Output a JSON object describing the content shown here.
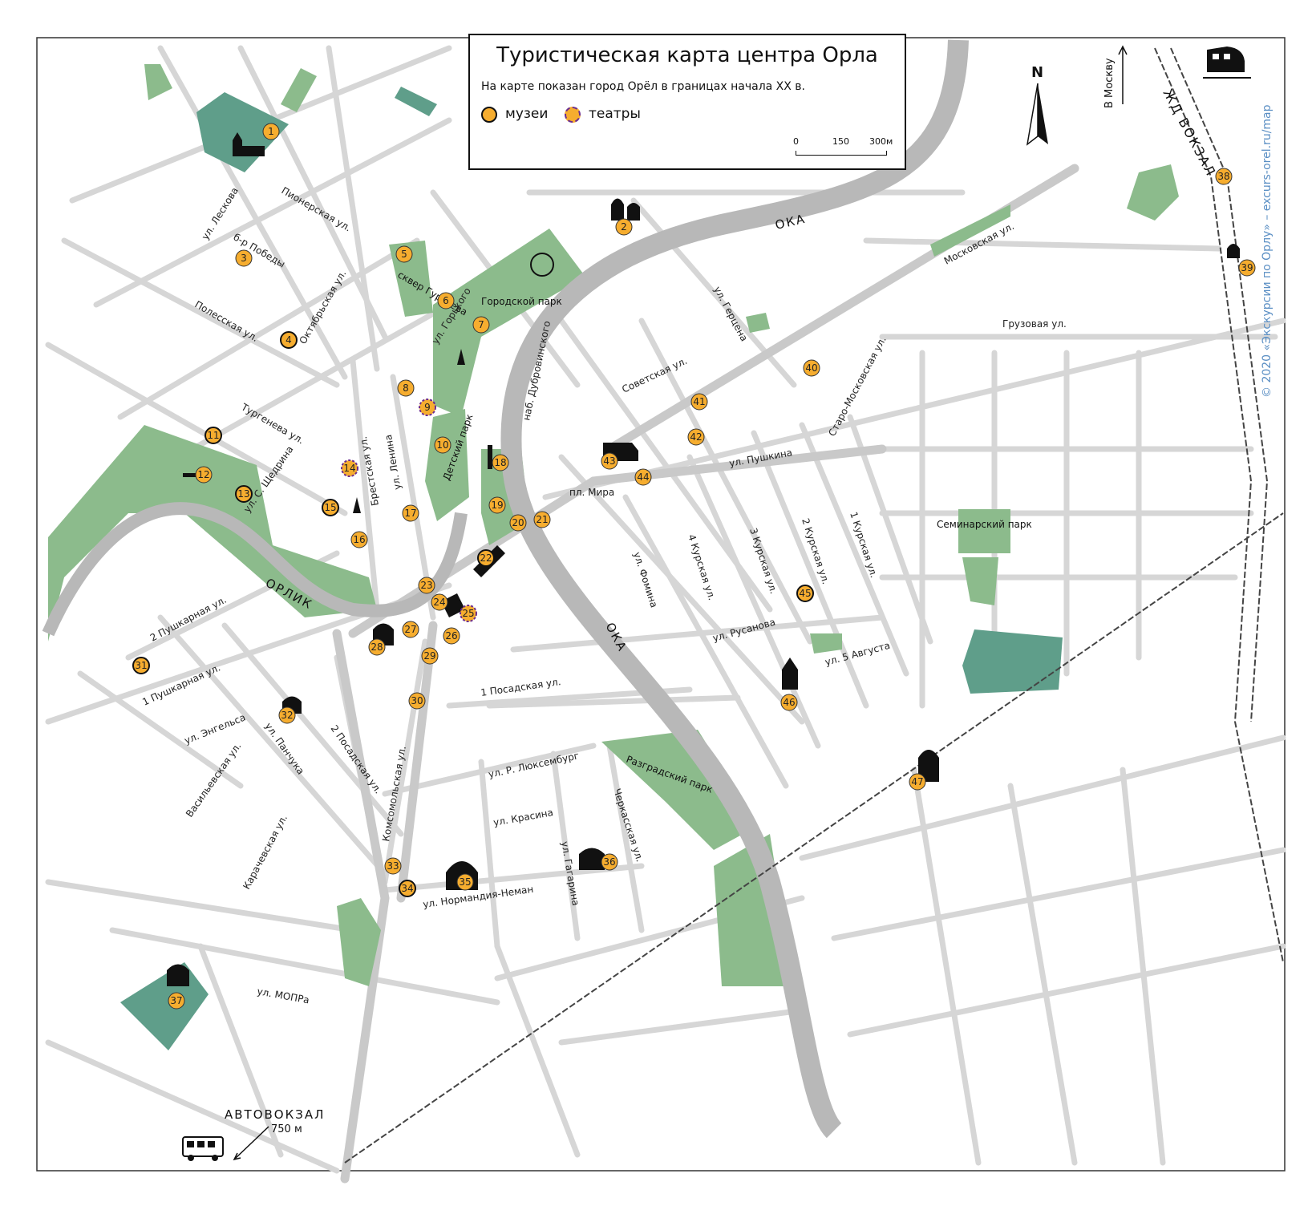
{
  "legend": {
    "title": "Туристическая карта центра Орла",
    "subtitle": "На карте показан город Орёл в границах начала XX в.",
    "museums_label": "музеи",
    "theatres_label": "театры",
    "scale_ticks": [
      "0",
      "150",
      "300м"
    ]
  },
  "compass": {
    "label": "N"
  },
  "direction": {
    "moscow": "В Москву",
    "railway_station": "ЖД ВОКЗАЛ"
  },
  "bus_station": {
    "label": "АВТОВОКЗАЛ",
    "distance": "750 м"
  },
  "copyright": "© 2020 «Экскурсии по Орлу» – excurs-orel.ru/map",
  "rivers": {
    "oka": "ОКА",
    "orlik": "ОРЛИК"
  },
  "parks": {
    "gorodskoy": "Городской парк",
    "detskiy": "Детский парк",
    "skver": "сквер Гуртьева",
    "seminarskiy": "Семинарский парк",
    "razgradskiy": "Разградский парк"
  },
  "streets": {
    "leskova": "ул. Лескова",
    "pionerskaya": "Пионерская ул.",
    "pobedy": "б-р Победы",
    "polesskaya": "Полесская ул.",
    "oktyabrskaya": "Октябрьская ул.",
    "gorkogo": "ул. Горького",
    "turgeneva": "Тургенева ул.",
    "shchedrina": "ул. С. Щедрина",
    "brestskaya": "Брестская ул.",
    "lenina": "ул. Ленина",
    "dubrovinskogo": "наб. Дубровинского",
    "sovetskaya": "Советская ул.",
    "gertsena": "ул. Герцена",
    "moskovskaya": "Московская ул.",
    "gruzovaya": "Грузовая ул.",
    "staro_moskovskaya": "Старо-Московская ул.",
    "pushkina": "ул. Пушкина",
    "pl_mira": "пл. Мира",
    "fomina": "ул. Фомина",
    "kurskaya4": "4 Курская ул.",
    "kurskaya3": "3 Курская ул.",
    "kurskaya2": "2 Курская ул.",
    "kurskaya1": "1 Курская ул.",
    "rusanova": "ул. Русанова",
    "avgusta": "ул. 5 Августа",
    "pushkarnaya2": "2 Пушкарная ул.",
    "pushkarnaya1": "1 Пушкарная ул.",
    "posadskaya1": "1 Посадская ул.",
    "posadskaya2": "2 Посадская ул.",
    "engelsa": "ул. Энгельса",
    "panchuka": "ул. Панчука",
    "vasilevskaya": "Васильевская ул.",
    "komsomolskaya": "Комсомольская ул.",
    "lyuksemburg": "ул. Р. Люксембург",
    "cherkasskaya": "Черкасская ул.",
    "krasina": "ул. Красина",
    "gagarina": "ул. Гагарина",
    "normandiya": "ул. Нормандия-Неман",
    "karachevskaya": "Карачевская ул.",
    "mopra": "ул. МОПРа"
  },
  "pois": {
    "p1": "1",
    "p2": "2",
    "p3": "3",
    "p4": "4",
    "p5": "5",
    "p6": "6",
    "p7": "7",
    "p8": "8",
    "p9": "9",
    "p10": "10",
    "p11": "11",
    "p12": "12",
    "p13": "13",
    "p14": "14",
    "p15": "15",
    "p16": "16",
    "p17": "17",
    "p18": "18",
    "p19": "19",
    "p20": "20",
    "p21": "21",
    "p22": "22",
    "p23": "23",
    "p24": "24",
    "p25": "25",
    "p26": "26",
    "p27": "27",
    "p28": "28",
    "p29": "29",
    "p30": "30",
    "p31": "31",
    "p32": "32",
    "p33": "33",
    "p34": "34",
    "p35": "35",
    "p36": "36",
    "p37": "37",
    "p38": "38",
    "p39": "39",
    "p40": "40",
    "p41": "41",
    "p42": "42",
    "p43": "43",
    "p44": "44",
    "p45": "45",
    "p46": "46",
    "p47": "47"
  },
  "colors": {
    "park": "#8cbb8c",
    "park_dark": "#5f9e8a",
    "river": "#b8b8b8",
    "road": "#d6d6d6",
    "museum": "#f6ad2f",
    "theatre_border": "#6b2d8f"
  }
}
